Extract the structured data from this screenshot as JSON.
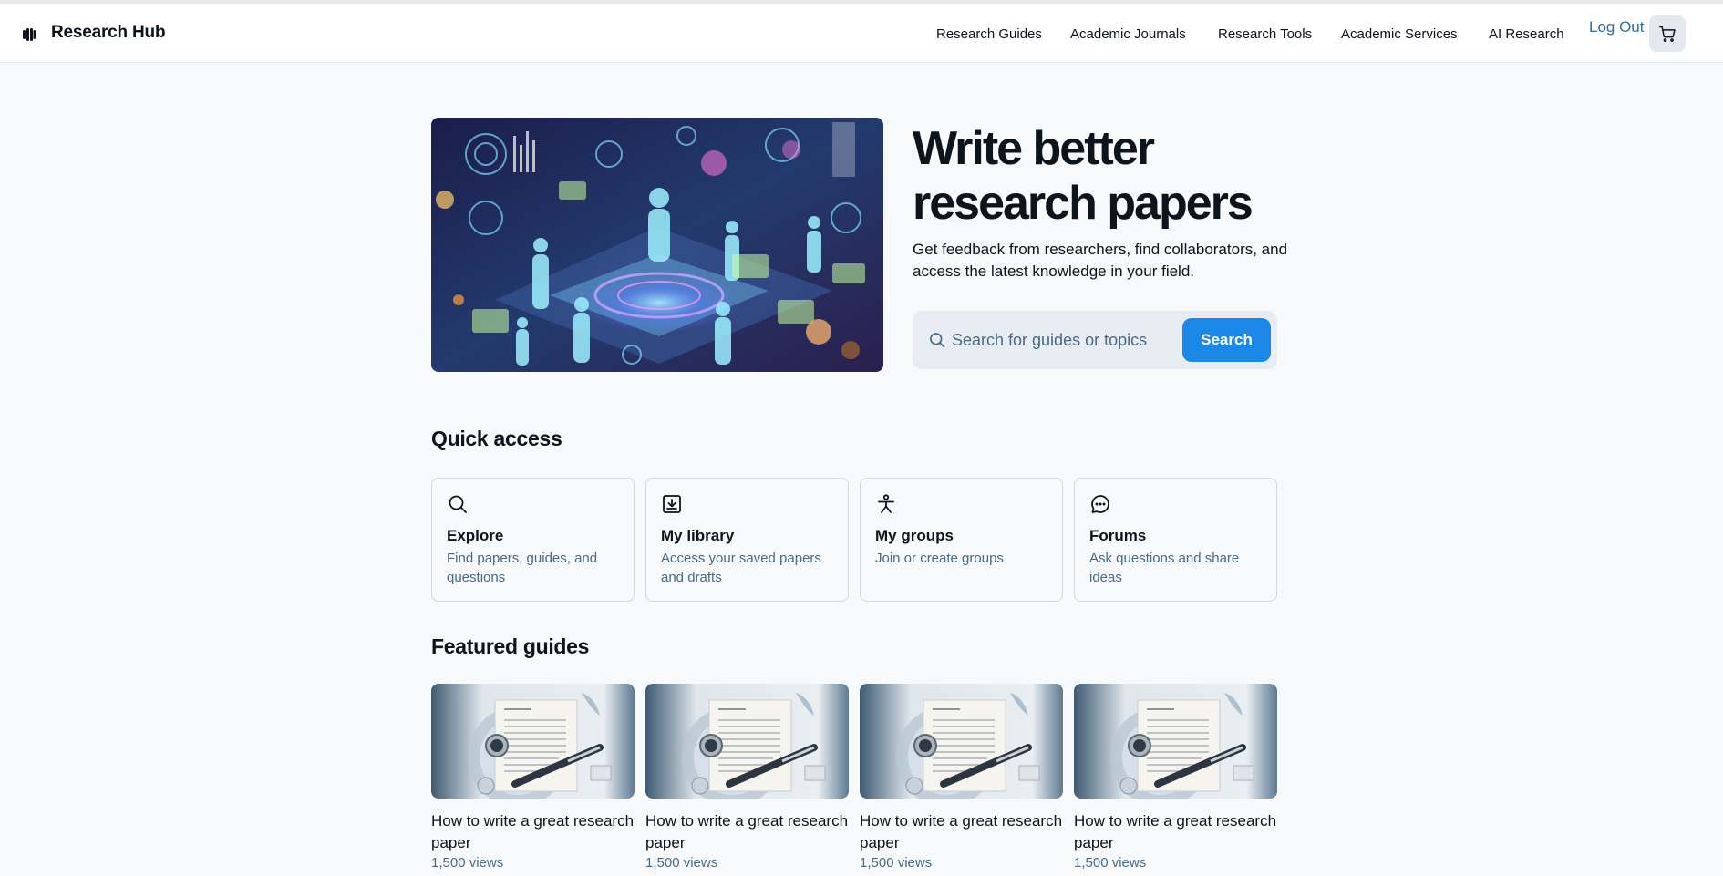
{
  "header": {
    "brand": "Research Hub",
    "nav": [
      "Research Guides",
      "Academic Journals",
      "Research Tools",
      "Academic Services",
      "AI Research"
    ],
    "logout": "Log Out",
    "cart_icon": "cart-icon",
    "logo_icon": "logo-icon"
  },
  "hero": {
    "title": "Write better research papers",
    "subtitle": "Get feedback from researchers, find collaborators, and access the latest knowledge in your field.",
    "search_placeholder": "Search for guides or topics",
    "search_value": "",
    "search_button": "Search",
    "image": "futuristic-research-illustration"
  },
  "quick_access": {
    "title": "Quick access",
    "items": [
      {
        "title": "Explore",
        "desc": "Find papers, guides, and questions",
        "icon": "search-icon"
      },
      {
        "title": "My library",
        "desc": "Access your saved papers and drafts",
        "icon": "download-box-icon"
      },
      {
        "title": "My groups",
        "desc": "Join or create groups",
        "icon": "person-icon"
      },
      {
        "title": "Forums",
        "desc": "Ask questions and share ideas",
        "icon": "chat-bubble-icon"
      }
    ]
  },
  "featured": {
    "title": "Featured guides",
    "items": [
      {
        "title": "How to write a great research paper",
        "views": "1,500 views"
      },
      {
        "title": "How to write a great research paper",
        "views": "1,500 views"
      },
      {
        "title": "How to write a great research paper",
        "views": "1,500 views"
      },
      {
        "title": "How to write a great research paper",
        "views": "1,500 views"
      }
    ]
  },
  "colors": {
    "accent": "#1b87e6",
    "link": "#2f6ea1",
    "muted_text": "#4a6a85",
    "background": "#f7f9fb"
  }
}
